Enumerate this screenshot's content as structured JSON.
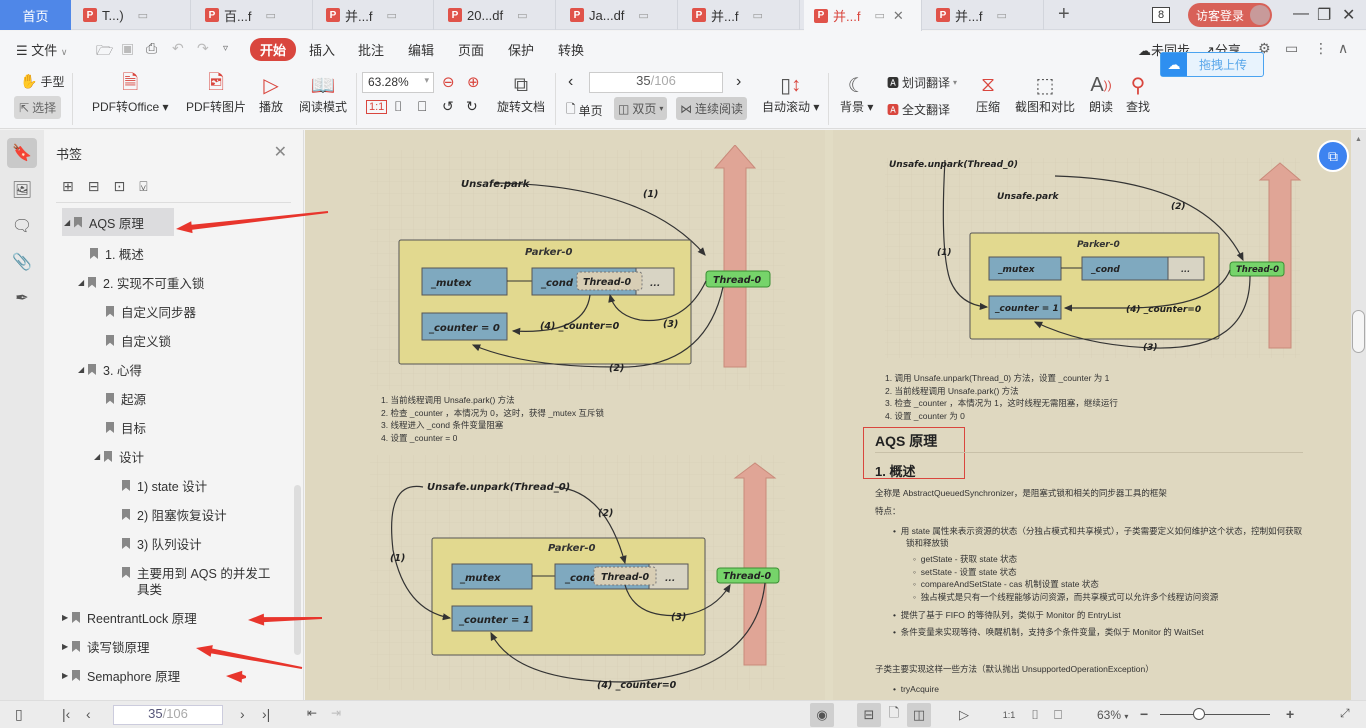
{
  "tabs": {
    "home": "首页",
    "items": [
      {
        "label": "T...)",
        "active": false
      },
      {
        "label": "百...f",
        "active": false
      },
      {
        "label": "并...f",
        "active": false
      },
      {
        "label": "20...df",
        "active": false
      },
      {
        "label": "Ja...df",
        "active": false
      },
      {
        "label": "并...f",
        "active": false
      },
      {
        "label": "并...f",
        "active": true
      },
      {
        "label": "并...f",
        "active": false
      }
    ],
    "new_tab": "+",
    "window_count": "8",
    "login": "访客登录"
  },
  "menu": {
    "file": "文件",
    "items": [
      "开始",
      "插入",
      "批注",
      "编辑",
      "页面",
      "保护",
      "转换"
    ],
    "active": "开始",
    "sync": "未同步",
    "share": "分享",
    "upload_popup": "拖拽上传"
  },
  "toolbar": {
    "hand": "手型",
    "select": "选择",
    "pdf_to_office": "PDF转Office",
    "pdf_to_image": "PDF转图片",
    "play": "播放",
    "read_mode": "阅读模式",
    "zoom_value": "63.28%",
    "rotate_doc": "旋转文档",
    "page_current": "35",
    "page_total": "/106",
    "single_page": "单页",
    "double_page": "双页",
    "continuous": "连续阅读",
    "auto_scroll": "自动滚动",
    "background": "背景",
    "word_translate": "划词翻译",
    "full_translate": "全文翻译",
    "compress": "压缩",
    "screenshot_compare": "截图和对比",
    "read_aloud": "朗读",
    "find": "查找"
  },
  "sidebar": {
    "title": "书签",
    "bookmarks": [
      {
        "label": "AQS 原理",
        "level": 0,
        "expand": "open",
        "selected": true
      },
      {
        "label": "1. 概述",
        "level": 1,
        "expand": "none"
      },
      {
        "label": "2. 实现不可重入锁",
        "level": 1,
        "expand": "open"
      },
      {
        "label": "自定义同步器",
        "level": 2,
        "expand": "none"
      },
      {
        "label": "自定义锁",
        "level": 2,
        "expand": "none"
      },
      {
        "label": "3. 心得",
        "level": 1,
        "expand": "open"
      },
      {
        "label": "起源",
        "level": 2,
        "expand": "none"
      },
      {
        "label": "目标",
        "level": 2,
        "expand": "none"
      },
      {
        "label": "设计",
        "level": 2,
        "expand": "open"
      },
      {
        "label": "1) state 设计",
        "level": 3,
        "expand": "none"
      },
      {
        "label": "2) 阻塞恢复设计",
        "level": 3,
        "expand": "none"
      },
      {
        "label": "3) 队列设计",
        "level": 3,
        "expand": "none"
      },
      {
        "label": "主要用到 AQS 的并发工",
        "label2": "具类",
        "level": 3,
        "expand": "none"
      },
      {
        "label": "ReentrantLock 原理",
        "level": 0,
        "expand": "closed"
      },
      {
        "label": "读写锁原理",
        "level": 0,
        "expand": "closed"
      },
      {
        "label": "Semaphore 原理",
        "level": 0,
        "expand": "closed"
      }
    ]
  },
  "document": {
    "left_page": {
      "diagram1": {
        "call": "Unsafe.park",
        "parker": "Parker-0",
        "mutex": "_mutex",
        "cond": "_cond",
        "cond_thread": "Thread-0",
        "ellipsis": "...",
        "counter": "_counter = 0",
        "thread": "Thread-0",
        "s1": "(1)",
        "s2": "(2)",
        "s3": "(3)",
        "s4": "(4) _counter=0"
      },
      "steps1": [
        "1. 当前线程调用 Unsafe.park() 方法",
        "2. 检查 _counter ，本情况为 0，这时，获得 _mutex 互斥锁",
        "3. 线程进入 _cond 条件变量阻塞",
        "4. 设置 _counter = 0"
      ],
      "diagram2": {
        "call": "Unsafe.unpark(Thread_0)",
        "parker": "Parker-0",
        "mutex": "_mutex",
        "cond": "_cond",
        "cond_thread": "Thread-0",
        "ellipsis": "...",
        "counter": "_counter = 1",
        "thread": "Thread-0",
        "s1": "(1)",
        "s2": "(2)",
        "s3": "(3)",
        "s4": "(4) _counter=0"
      }
    },
    "right_page": {
      "diagram3": {
        "call1": "Unsafe.unpark(Thread_0)",
        "call2": "Unsafe.park",
        "parker": "Parker-0",
        "mutex": "_mutex",
        "cond": "_cond",
        "ellipsis": "...",
        "counter": "_counter = 1",
        "thread": "Thread-0",
        "s1": "(1)",
        "s2": "(2)",
        "s3": "(3)",
        "s4": "(4) _counter=0"
      },
      "steps3": [
        "1. 调用 Unsafe.unpark(Thread_0) 方法，设置 _counter 为 1",
        "2. 当前线程调用 Unsafe.park() 方法",
        "3. 检查 _counter ，本情况为 1，这时线程无需阻塞，继续运行",
        "4. 设置 _counter 为 0"
      ],
      "heading1": "AQS 原理",
      "heading2": "1. 概述",
      "intro": "全称是 AbstractQueuedSynchronizer，是阻塞式锁和相关的同步器工具的框架",
      "features_label": "特点：",
      "bullet1": "用 state 属性来表示资源的状态（分独占模式和共享模式），子类需要定义如何维护这个状态，控制如何获取",
      "bullet1b": "锁和释放锁",
      "sub": [
        "getState - 获取 state 状态",
        "setState - 设置 state 状态",
        "compareAndSetState - cas 机制设置 state 状态",
        "独占模式是只有一个线程能够访问资源，而共享模式可以允许多个线程访问资源"
      ],
      "bullet2": "提供了基于 FIFO 的等待队列，类似于 Monitor 的 EntryList",
      "bullet3": "条件变量来实现等待、唤醒机制，支持多个条件变量，类似于 Monitor 的 WaitSet",
      "methods_intro": "子类主要实现这样一些方法（默认抛出 UnsupportedOperationException）",
      "method1": "tryAcquire"
    }
  },
  "statusbar": {
    "page_current": "35",
    "page_total": "/106",
    "zoom": "63%",
    "zoom_fraction": 0.35
  }
}
